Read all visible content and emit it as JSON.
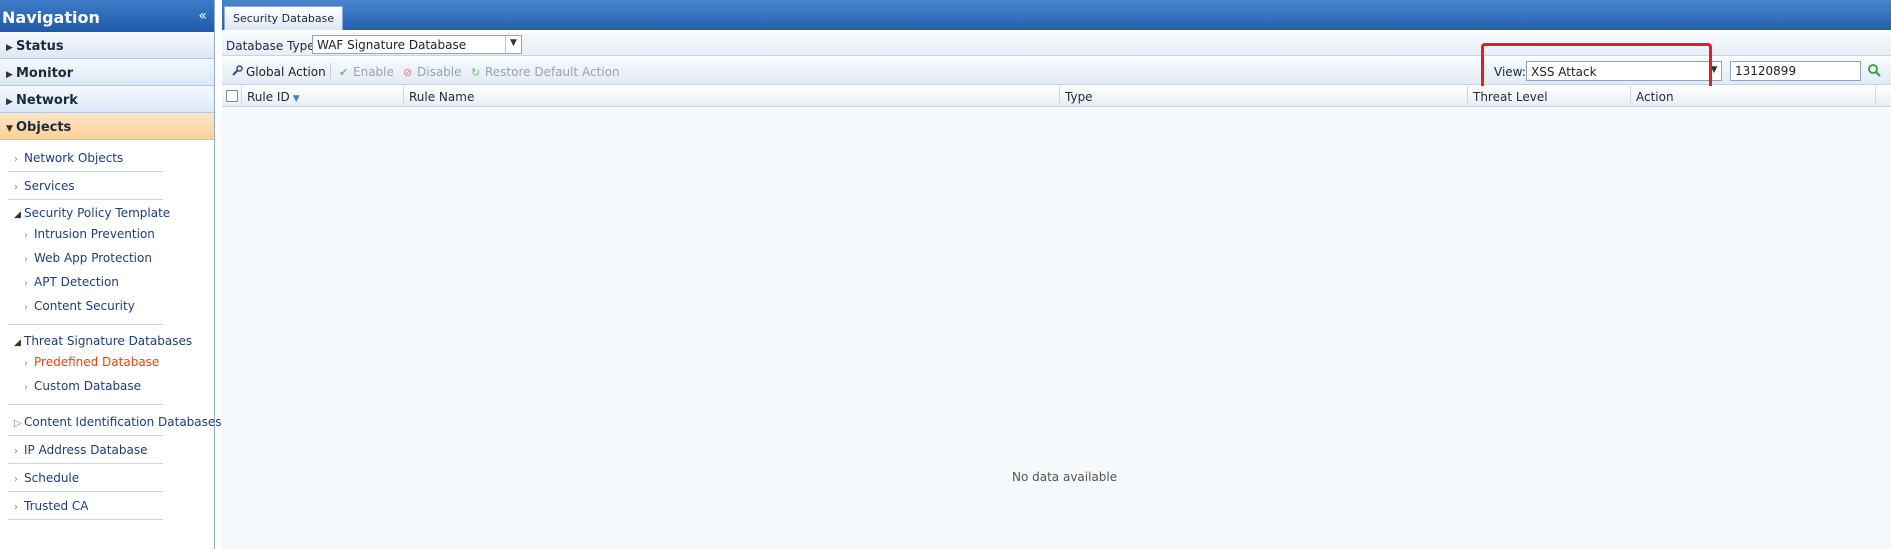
{
  "sidebar": {
    "title": "Navigation",
    "collapse_glyph": "«",
    "sections": [
      {
        "label": "Status"
      },
      {
        "label": "Monitor"
      },
      {
        "label": "Network"
      },
      {
        "label": "Objects"
      }
    ],
    "items": {
      "network_objects": "Network Objects",
      "services": "Services",
      "security_policy_template": "Security Policy Template",
      "intrusion_prevention": "Intrusion Prevention",
      "web_app_protection": "Web App Protection",
      "apt_detection": "APT Detection",
      "content_security": "Content Security",
      "threat_signature_databases": "Threat Signature Databases",
      "predefined_database": "Predefined Database",
      "custom_database": "Custom Database",
      "content_identification_databases": "Content Identification Databases",
      "ip_address_database": "IP Address Database",
      "schedule": "Schedule",
      "trusted_ca": "Trusted CA"
    }
  },
  "main": {
    "tab_label": "Security Database",
    "database_type_label": "Database Type:",
    "database_type_value": "WAF Signature Database",
    "toolbar": {
      "global_action": "Global Action",
      "enable": "Enable",
      "disable": "Disable",
      "restore_default": "Restore Default Action"
    },
    "view_label": "View:",
    "view_value": "XSS Attack",
    "search_value": "13120899",
    "table": {
      "columns": [
        "Rule ID",
        "Rule Name",
        "Type",
        "Threat Level",
        "Action"
      ],
      "empty_message": "No data available"
    }
  },
  "colors": {
    "accent": "#2660ad",
    "selected_item": "#e84317",
    "highlight_box": "#e02020"
  }
}
